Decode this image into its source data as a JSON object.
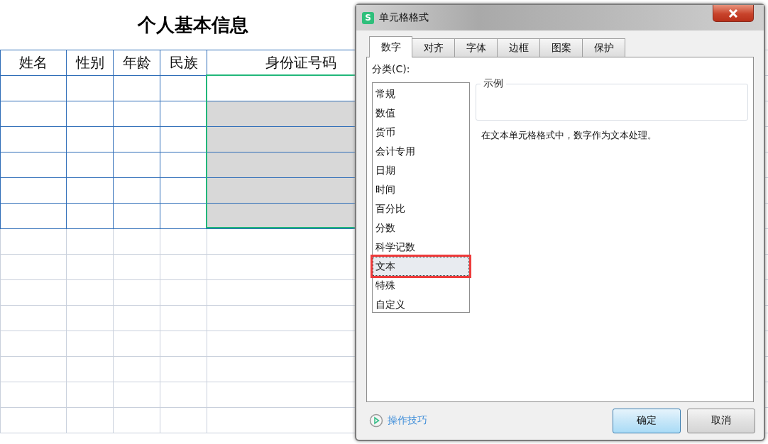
{
  "sheet": {
    "title": "个人基本信息",
    "columns": [
      "姓名",
      "性别",
      "年龄",
      "民族",
      "身份证号码"
    ],
    "rows": [
      {
        "shaded": false
      },
      {
        "shaded": true
      },
      {
        "shaded": true
      },
      {
        "shaded": true
      },
      {
        "shaded": true
      },
      {
        "shaded": true
      }
    ]
  },
  "dialog": {
    "icon_letter": "S",
    "title": "单元格格式",
    "tabs": [
      {
        "label": "数字",
        "selected": true
      },
      {
        "label": "对齐",
        "selected": false
      },
      {
        "label": "字体",
        "selected": false
      },
      {
        "label": "边框",
        "selected": false
      },
      {
        "label": "图案",
        "selected": false
      },
      {
        "label": "保护",
        "selected": false
      }
    ],
    "category_label": "分类(C):",
    "categories": [
      {
        "label": "常规",
        "selected": false,
        "marked": false
      },
      {
        "label": "数值",
        "selected": false,
        "marked": false
      },
      {
        "label": "货币",
        "selected": false,
        "marked": false
      },
      {
        "label": "会计专用",
        "selected": false,
        "marked": false
      },
      {
        "label": "日期",
        "selected": false,
        "marked": false
      },
      {
        "label": "时间",
        "selected": false,
        "marked": false
      },
      {
        "label": "百分比",
        "selected": false,
        "marked": false
      },
      {
        "label": "分数",
        "selected": false,
        "marked": false
      },
      {
        "label": "科学记数",
        "selected": false,
        "marked": false
      },
      {
        "label": "文本",
        "selected": true,
        "marked": true
      },
      {
        "label": "特殊",
        "selected": false,
        "marked": false
      },
      {
        "label": "自定义",
        "selected": false,
        "marked": false
      }
    ],
    "sample_label": "示例",
    "description": "在文本单元格格式中，数字作为文本处理。",
    "tips_link": "操作技巧",
    "buttons": [
      {
        "label": "确定",
        "kind": "default"
      },
      {
        "label": "取消",
        "kind": "normal"
      }
    ]
  }
}
